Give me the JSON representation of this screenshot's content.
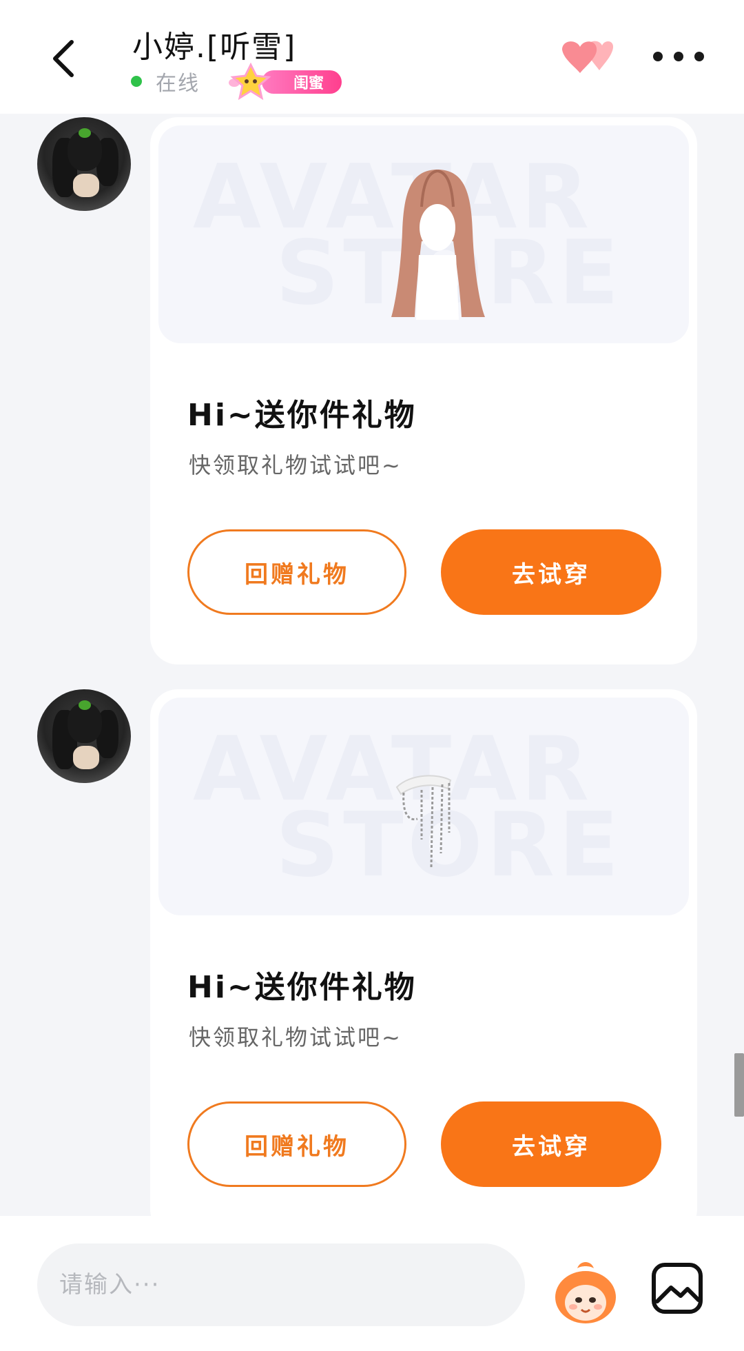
{
  "header": {
    "title": "小婷.[听雪]",
    "status": "在线",
    "badge_label": "闺蜜",
    "back_icon": "chevron-left-icon",
    "heart_icon": "hearts-icon",
    "more_icon": "more-dots-icon"
  },
  "messages": [
    {
      "watermark_top": "AVATAR",
      "watermark_bottom": "STORE",
      "item": "long brown hair wig",
      "title": "Hi~送你件礼物",
      "subtitle": "快领取礼物试试吧~",
      "secondary_button": "回赠礼物",
      "primary_button": "去试穿"
    },
    {
      "watermark_top": "AVATAR",
      "watermark_bottom": "STORE",
      "item": "white hair clip with chain tassels",
      "title": "Hi~送你件礼物",
      "subtitle": "快领取礼物试试吧~",
      "secondary_button": "回赠礼物",
      "primary_button": "去试穿"
    }
  ],
  "composer": {
    "placeholder": "请输入···",
    "mascot_icon": "mascot-avatar-icon",
    "image_icon": "image-icon"
  },
  "colors": {
    "accent": "#f97517",
    "online": "#2fc24a",
    "badge": "#ff4f98",
    "background": "#f4f5f8"
  }
}
